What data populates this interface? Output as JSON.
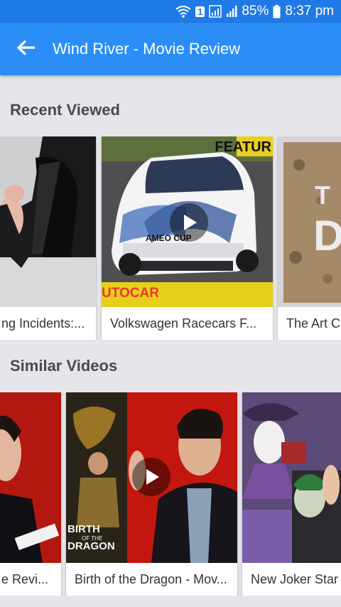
{
  "status_bar": {
    "battery_percent": "85%",
    "time": "8:37 pm",
    "sim_badge": "1"
  },
  "app_bar": {
    "title": "Wind River - Movie Review"
  },
  "recent": {
    "title": "Recent Viewed",
    "cards": [
      {
        "caption": "ng Incidents:..."
      },
      {
        "caption": "Volkswagen Racecars  F...",
        "overlay_top": "FEATUR",
        "overlay_bottom": "UTOCAR",
        "car_text": "AMEO CUP"
      },
      {
        "caption": "The Art C"
      }
    ]
  },
  "similar": {
    "title": "Similar Videos",
    "cards": [
      {
        "caption": "e Revi..."
      },
      {
        "caption": "Birth of the Dragon - Mov...",
        "poster_line1": "BIRTH",
        "poster_line2": "OF THE",
        "poster_line3": "DRAGON"
      },
      {
        "caption": "New Joker Star"
      }
    ]
  },
  "colors": {
    "status_bar": "#1f7ae6",
    "app_bar": "#2b8ef6",
    "background": "#e6e6ea"
  }
}
